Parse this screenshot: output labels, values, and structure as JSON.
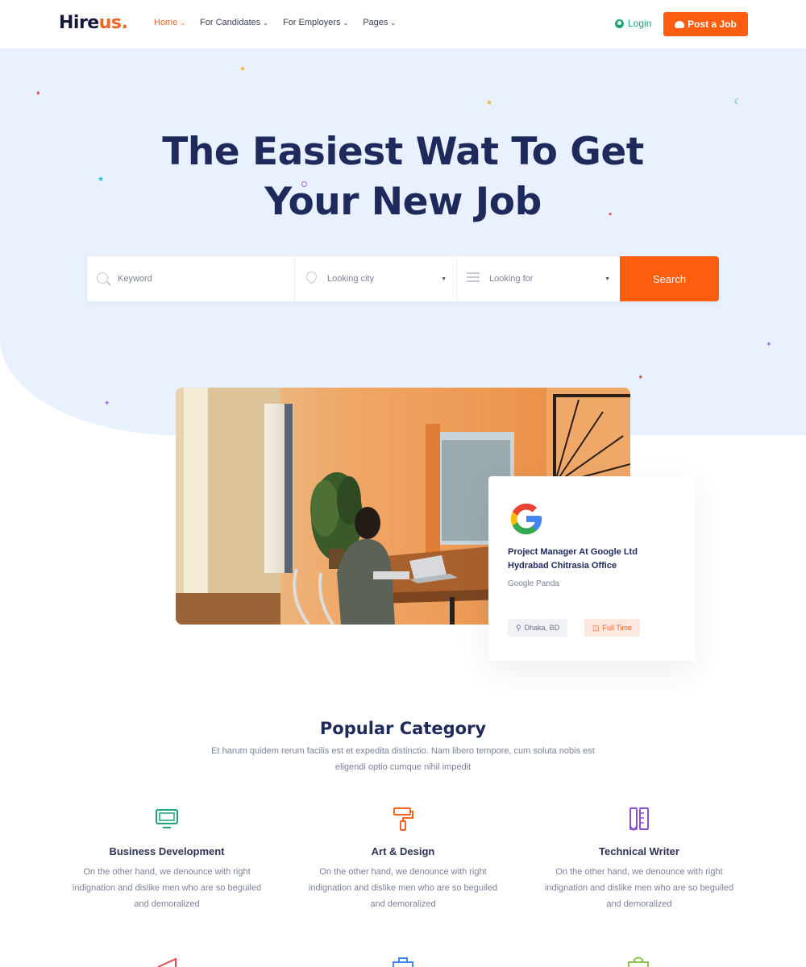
{
  "header": {
    "logo_main": "Hire",
    "logo_accent": "us.",
    "nav": [
      {
        "label": "Home",
        "active": true
      },
      {
        "label": "For Candidates",
        "active": false
      },
      {
        "label": "For Employers",
        "active": false
      },
      {
        "label": "Pages",
        "active": false
      }
    ],
    "login_label": "Login",
    "post_job_label": "Post a Job"
  },
  "hero": {
    "title_line1": "The Easiest Wat To Get",
    "title_line2": "Your New Job",
    "search": {
      "keyword_placeholder": "Keyword",
      "city_placeholder": "Looking city",
      "looking_for_placeholder": "Looking for",
      "button_label": "Search"
    }
  },
  "job_card": {
    "title": "Project Manager At Google Ltd Hydrabad Chitrasia Office",
    "company": "Google Panda",
    "location": "Dhaka, BD",
    "type": "Full Time"
  },
  "categories": {
    "title": "Popular Category",
    "subtitle": "Et harum quidem rerum facilis est et expedita distinctio. Nam libero tempore, cum soluta nobis est eligendi optio cumque nihil impedit",
    "items": [
      {
        "title": "Business Development",
        "icon": "monitor-icon",
        "color": "#1aa37a",
        "desc": "On the other hand, we denounce with right indignation and dislike men who are so beguiled and demoralized"
      },
      {
        "title": "Art & Design",
        "icon": "paint-roller-icon",
        "color": "#f26522",
        "desc": "On the other hand, we denounce with right indignation and dislike men who are so beguiled and demoralized"
      },
      {
        "title": "Technical Writer",
        "icon": "pencil-ruler-icon",
        "color": "#8a4fd8",
        "desc": "On the other hand, we denounce with right indignation and dislike men who are so beguiled and demoralized"
      }
    ]
  },
  "colors": {
    "accent": "#fd5d0e",
    "navy": "#1e2a5c",
    "hero_bg": "#e8f1fd",
    "green": "#1aa37a"
  }
}
